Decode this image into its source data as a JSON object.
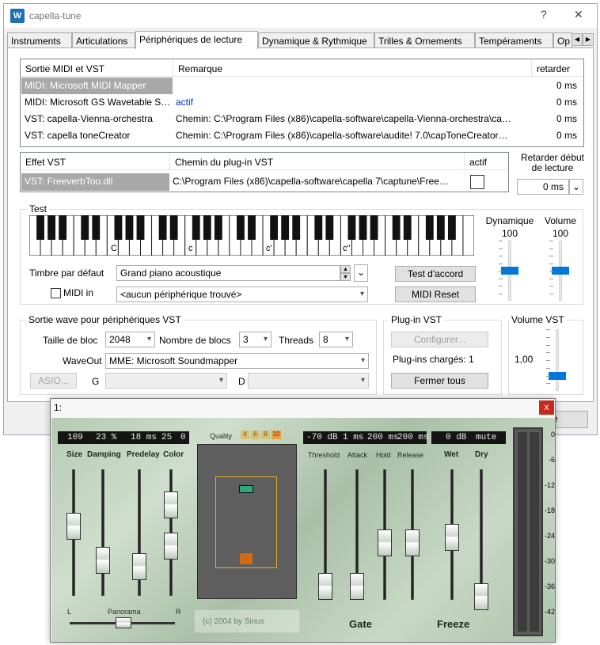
{
  "window": {
    "title": "capella-tune",
    "help": "?",
    "close": "✕",
    "app_icon": "W"
  },
  "tabs": [
    "Instruments",
    "Articulations",
    "Périphériques de lecture",
    "Dynamique & Rythmique",
    "Trilles & Ornements",
    "Tempéraments",
    "Op"
  ],
  "tab_scroll": {
    "left": "◀",
    "right": "▶"
  },
  "midi": {
    "headers": [
      "Sortie MIDI et VST",
      "Remarque",
      "retarder"
    ],
    "rows": [
      {
        "name": "MIDI: Microsoft MIDI Mapper",
        "note": "",
        "delay": "0 ms"
      },
      {
        "name": "MIDI: Microsoft GS Wavetable S…",
        "note": "actif",
        "delay": "0 ms"
      },
      {
        "name": "VST: capella-Vienna-orchestra",
        "note": "Chemin: C:\\Program Files (x86)\\capella-software\\capella-Vienna-orchestra\\ca…",
        "delay": "0 ms"
      },
      {
        "name": "VST: capella toneCreator",
        "note": "Chemin: C:\\Program Files (x86)\\capella-software\\audite! 7.0\\capToneCreator…",
        "delay": "0 ms"
      }
    ]
  },
  "effect": {
    "headers": [
      "Effet VST",
      "Chemin du plug-in VST",
      "actif"
    ],
    "name": "VST: FreeverbToo.dll",
    "path": "C:\\Program Files (x86)\\capella-software\\capella 7\\captune\\Free…"
  },
  "delay_start": {
    "label1": "Retarder début",
    "label2": "de lecture",
    "value": "0 ms"
  },
  "test": {
    "label": "Test",
    "keys": [
      "C",
      "c",
      "c'",
      "c''"
    ],
    "timbre_label": "Timbre par défaut",
    "timbre_value": "Grand piano acoustique",
    "midi_in": "MIDI in",
    "device": "<aucun périphérique trouvé>",
    "chord_btn": "Test d'accord",
    "reset_btn": "MIDI Reset",
    "dyn_label": "Dynamique",
    "dyn_value": "100",
    "dyn_level": 0.5,
    "vol_label": "Volume",
    "vol_value": "100",
    "vol_level": 0.5
  },
  "wave": {
    "label": "Sortie wave pour périphériques VST",
    "bloc_label": "Taille de bloc",
    "bloc_value": "2048",
    "nb_label": "Nombre de blocs",
    "nb_value": "3",
    "threads_label": "Threads",
    "threads_value": "8",
    "waveout_label": "WaveOut",
    "waveout_value": "MME: Microsoft Soundmapper",
    "asio": "ASIO...",
    "g": "G",
    "d": "D"
  },
  "plugin": {
    "label": "Plug-in VST",
    "config": "Configurer...",
    "loaded": "Plug-ins chargés: 1",
    "close_all": "Fermer tous"
  },
  "vst_volume": {
    "label": "Volume VST",
    "value": "1,00",
    "level": 0.2
  },
  "behind_button": "e",
  "freeverb": {
    "title": "1:",
    "close": "x",
    "lcd_left": [
      "109",
      "23 %",
      "18 ms",
      "25",
      "0"
    ],
    "labels_left": [
      "Size",
      "Damping",
      "Predelay",
      "Color"
    ],
    "quality_label": "Quality",
    "quality": [
      "4",
      "6",
      "8",
      "10"
    ],
    "lcd_gate": [
      "-70 dB",
      "1 ms",
      "200 ms",
      "200 ms"
    ],
    "labels_gate": [
      "Threshold",
      "Attack",
      "Hold",
      "Release"
    ],
    "lcd_wet": [
      "0 dB",
      "mute"
    ],
    "labels_wet": [
      "Wet",
      "Dry"
    ],
    "panorama": "Panorama",
    "pan_l": "L",
    "pan_r": "R",
    "copyright": "(c) 2004 by Sinus",
    "gate": "Gate",
    "freeze": "Freeze",
    "scale": [
      "0",
      "-6",
      "-12",
      "-18",
      "-24",
      "-30",
      "-36",
      "-42"
    ]
  }
}
